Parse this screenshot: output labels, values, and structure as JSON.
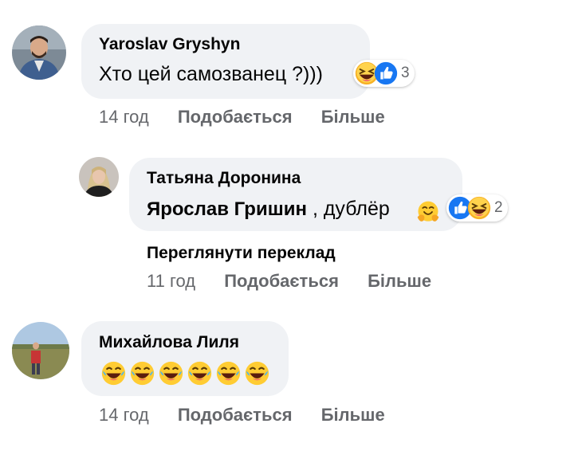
{
  "comments": [
    {
      "author": "Yaroslav Gryshyn",
      "text": "Хто цей самозванец ?)))",
      "reaction_count": "3",
      "time": "14 год",
      "like_label": "Подобається",
      "more_label": "Більше"
    },
    {
      "author": "Татьяна Доронина",
      "mention": "Ярослав Гришин",
      "text": ", дублёр",
      "reaction_count": "2",
      "translate_label": "Переглянути переклад",
      "time": "11 год",
      "like_label": "Подобається",
      "more_label": "Більше"
    },
    {
      "author": "Михайлова Лиля",
      "time": "14 год",
      "like_label": "Подобається",
      "more_label": "Більше"
    }
  ],
  "colors": {
    "bubble": "#f0f2f5",
    "meta": "#65676b",
    "like_blue": "#1877f2",
    "emoji_yellow": "#ffcc33"
  },
  "icons": [
    "laughing-emoji",
    "like-icon",
    "hugging-emoji",
    "tears-of-joy-emoji"
  ]
}
